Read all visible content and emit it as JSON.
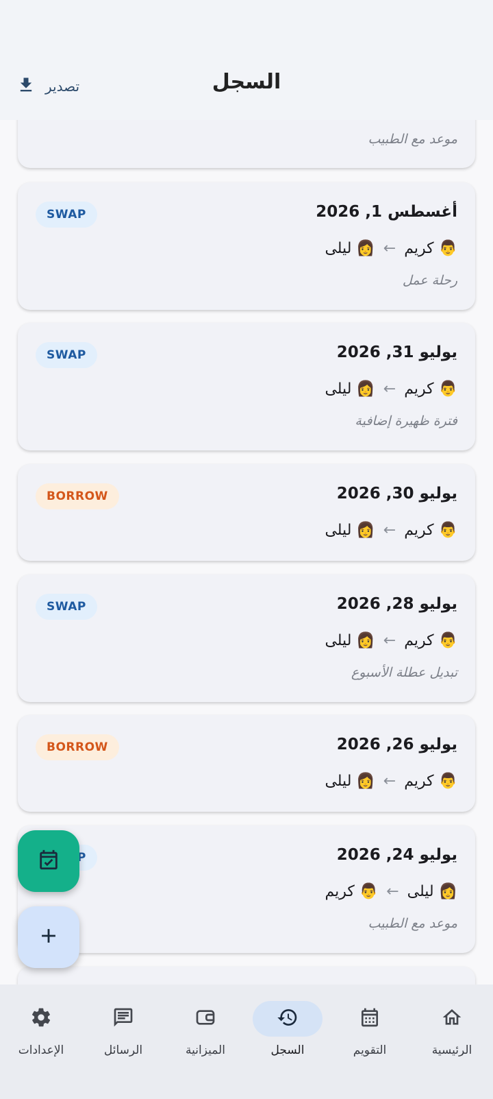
{
  "header": {
    "title": "السجل",
    "export_label": "تصدير"
  },
  "entries": [
    {
      "note": "موعد مع الطبيب"
    },
    {
      "date": "أغسطس 1, 2026",
      "from": "👨 كريم",
      "to": "👩 ليلى",
      "arrow": "←",
      "type": "SWAP",
      "note": "رحلة عمل"
    },
    {
      "date": "يوليو 31, 2026",
      "from": "👨 كريم",
      "to": "👩 ليلى",
      "arrow": "←",
      "type": "SWAP",
      "note": "فترة ظهيرة إضافية"
    },
    {
      "date": "يوليو 30, 2026",
      "from": "👨 كريم",
      "to": "👩 ليلى",
      "arrow": "←",
      "type": "BORROW",
      "note": ""
    },
    {
      "date": "يوليو 28, 2026",
      "from": "👨 كريم",
      "to": "👩 ليلى",
      "arrow": "←",
      "type": "SWAP",
      "note": "تبديل عطلة الأسبوع"
    },
    {
      "date": "يوليو 26, 2026",
      "from": "👨 كريم",
      "to": "👩 ليلى",
      "arrow": "←",
      "type": "BORROW",
      "note": ""
    },
    {
      "date": "يوليو 24, 2026",
      "from": "👩 ليلى",
      "to": "👨 كريم",
      "arrow": "←",
      "type": "SWAP",
      "note": "موعد مع الطبيب"
    }
  ],
  "fabs": {
    "calendar_icon": "calendar-check-icon",
    "add_icon": "plus-icon"
  },
  "nav": {
    "items": [
      {
        "label": "الرئيسية",
        "icon": "home-icon"
      },
      {
        "label": "التقويم",
        "icon": "calendar-icon"
      },
      {
        "label": "السجل",
        "icon": "history-icon",
        "active": true
      },
      {
        "label": "الميزانية",
        "icon": "wallet-icon"
      },
      {
        "label": "الرسائل",
        "icon": "message-icon"
      },
      {
        "label": "الإعدادات",
        "icon": "settings-icon"
      }
    ]
  },
  "colors": {
    "swap_badge_bg": "#e2effc",
    "swap_badge_text": "#1e5aa0",
    "borrow_badge_bg": "#fdeedd",
    "borrow_badge_text": "#d4561a",
    "fab_calendar": "#14b08a",
    "fab_add": "#d3e3fb",
    "nav_active": "#d5e3f6"
  }
}
